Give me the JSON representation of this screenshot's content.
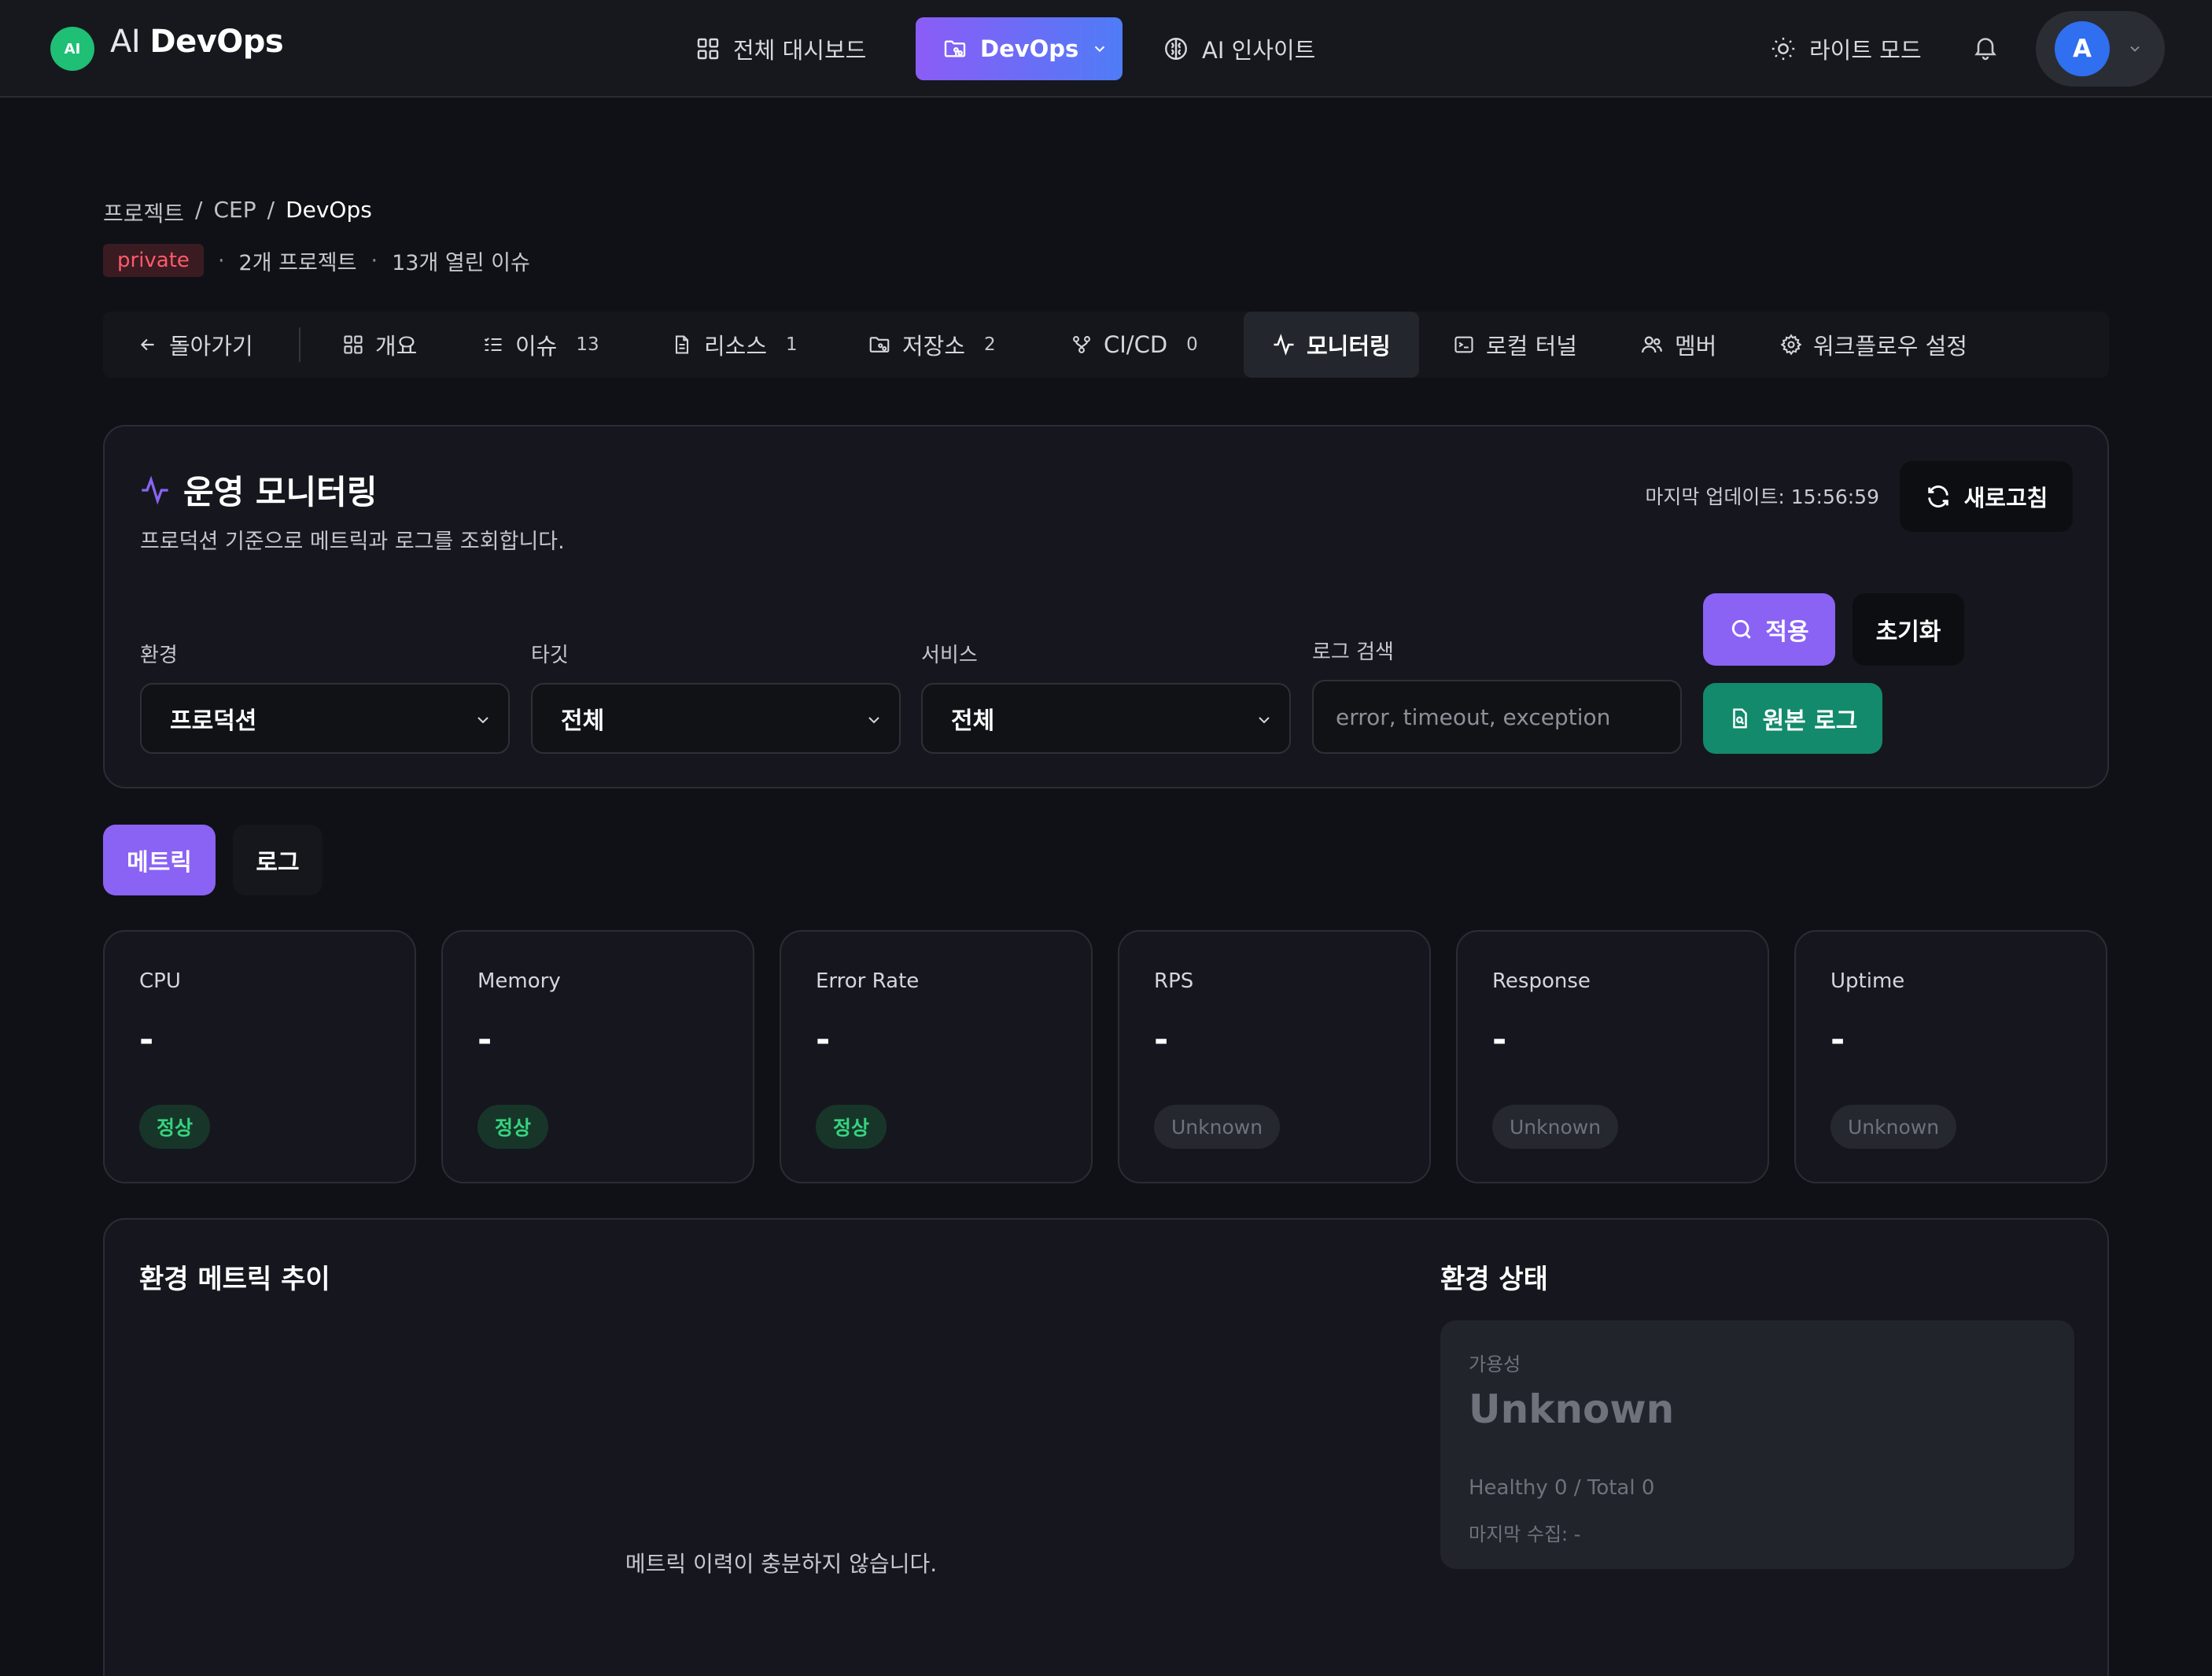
{
  "app": {
    "logo_badge": "AI",
    "logo_prefix": "AI",
    "logo_name": "DevOps"
  },
  "topnav": {
    "dashboard": "전체 대시보드",
    "devops": "DevOps",
    "insight": "AI 인사이트",
    "light_mode": "라이트 모드",
    "avatar_initial": "A"
  },
  "breadcrumb": {
    "root": "프로젝트",
    "sep": "/",
    "group": "CEP",
    "current": "DevOps"
  },
  "meta": {
    "visibility": "private",
    "dot": "·",
    "projects": "2개 프로젝트",
    "issues": "13개 열린 이슈"
  },
  "project_tabs": {
    "back": "돌아가기",
    "overview": "개요",
    "issues": "이슈",
    "issues_count": "13",
    "resources": "리소스",
    "resources_count": "1",
    "repos": "저장소",
    "repos_count": "2",
    "cicd": "CI/CD",
    "cicd_count": "0",
    "monitoring": "모니터링",
    "tunnel": "로컬 터널",
    "members": "멤버",
    "workflow": "워크플로우 설정"
  },
  "monitoring": {
    "title": "운영 모니터링",
    "description": "프로덕션 기준으로 메트릭과 로그를 조회합니다.",
    "last_update": "마지막 업데이트: 15:56:59",
    "refresh": "새로고침",
    "filters": {
      "env_label": "환경",
      "env_value": "프로덕션",
      "target_label": "타깃",
      "target_value": "전체",
      "service_label": "서비스",
      "service_value": "전체",
      "log_search_label": "로그 검색",
      "log_search_placeholder": "error, timeout, exception"
    },
    "apply": "적용",
    "reset": "초기화",
    "raw_log": "원본 로그"
  },
  "view_tabs": {
    "metrics": "메트릭",
    "logs": "로그"
  },
  "metrics": [
    {
      "label": "CPU",
      "value": "-",
      "status": "정상",
      "kind": "ok"
    },
    {
      "label": "Memory",
      "value": "-",
      "status": "정상",
      "kind": "ok"
    },
    {
      "label": "Error Rate",
      "value": "-",
      "status": "정상",
      "kind": "ok"
    },
    {
      "label": "RPS",
      "value": "-",
      "status": "Unknown",
      "kind": "unk"
    },
    {
      "label": "Response",
      "value": "-",
      "status": "Unknown",
      "kind": "unk"
    },
    {
      "label": "Uptime",
      "value": "-",
      "status": "Unknown",
      "kind": "unk"
    }
  ],
  "trend": {
    "title": "환경 메트릭 추이",
    "empty": "메트릭 이력이 충분하지 않습니다."
  },
  "env_status": {
    "title": "환경 상태",
    "availability_label": "가용성",
    "availability_value": "Unknown",
    "healthy_total": "Healthy 0 / Total 0",
    "last_collected": "마지막 수집: -"
  },
  "colors": {
    "accent": "#8a63f4",
    "success": "#35d37f",
    "danger": "#ff5a6a",
    "teal": "#138a6c"
  }
}
